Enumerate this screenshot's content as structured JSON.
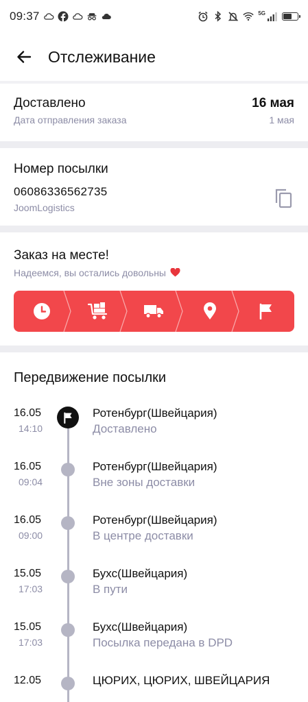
{
  "status_bar": {
    "time": "09:37",
    "network": "5G",
    "left_icons": [
      "cloud-icon",
      "facebook-icon",
      "cloud-icon",
      "incognito-icon",
      "cloud-icon"
    ],
    "right_icons": [
      "alarm-icon",
      "bluetooth-icon",
      "mute-icon",
      "wifi-icon",
      "signal-icon",
      "battery-icon"
    ]
  },
  "header": {
    "back_icon": "arrow-left-icon",
    "title": "Отслеживание"
  },
  "delivery": {
    "status": "Доставлено",
    "status_sub": "Дата отправления заказа",
    "date": "16 мая",
    "ship_date": "1 мая"
  },
  "parcel": {
    "label": "Номер посылки",
    "number": "06086336562735",
    "carrier": "JoomLogistics",
    "copy_icon": "copy-icon"
  },
  "arrived": {
    "title": "Заказ на месте!",
    "subtitle": "Надеемся, вы остались довольны",
    "heart_icon": "heart-icon",
    "accent_color": "#f2474b",
    "steps": [
      "clock-icon",
      "warehouse-cart-icon",
      "truck-icon",
      "location-pin-icon",
      "flag-icon"
    ]
  },
  "movement": {
    "title": "Передвижение посылки",
    "events": [
      {
        "date": "16.05",
        "time": "14:10",
        "place": "Ротенбург(Швейцария)",
        "status": "Доставлено",
        "active": true
      },
      {
        "date": "16.05",
        "time": "09:04",
        "place": "Ротенбург(Швейцария)",
        "status": "Вне зоны доставки",
        "active": false
      },
      {
        "date": "16.05",
        "time": "09:00",
        "place": "Ротенбург(Швейцария)",
        "status": "В центре доставки",
        "active": false
      },
      {
        "date": "15.05",
        "time": "17:03",
        "place": "Бухс(Швейцария)",
        "status": "В пути",
        "active": false
      },
      {
        "date": "15.05",
        "time": "17:03",
        "place": "Бухс(Швейцария)",
        "status": "Посылка передана в DPD",
        "active": false
      },
      {
        "date": "12.05",
        "time": "",
        "place": "ЦЮРИХ, ЦЮРИХ, ШВЕЙЦАРИЯ",
        "status": "",
        "active": false
      }
    ]
  }
}
